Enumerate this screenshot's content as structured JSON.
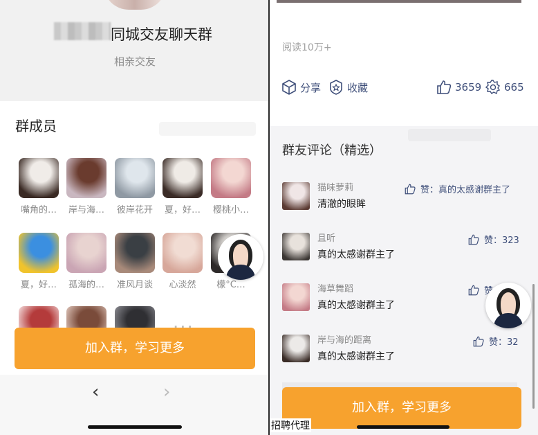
{
  "left": {
    "group_name": "同城交友聊天群",
    "group_subtitle": "相亲交友",
    "members_title": "群成员",
    "members": [
      {
        "name": "嘴角的…",
        "color1": "#f0ece8",
        "color2": "#3a2a24"
      },
      {
        "name": "岸与海…",
        "color1": "#6a3b2e",
        "color2": "#c9b7c0"
      },
      {
        "name": "彼岸花开",
        "color1": "#dfe6ec",
        "color2": "#8f99a3"
      },
      {
        "name": "夏，好…",
        "color1": "#efebe6",
        "color2": "#3b2c27"
      },
      {
        "name": "樱桃小…",
        "color1": "#f3d7d2",
        "color2": "#c47b86"
      },
      {
        "name": "夏，好…",
        "color1": "#3b8fe0",
        "color2": "#f0c32c"
      },
      {
        "name": "孤海的…",
        "color1": "#e8d3d0",
        "color2": "#caa5b4"
      },
      {
        "name": "准风月谈",
        "color1": "#3a3f44",
        "color2": "#a88a7a"
      },
      {
        "name": "心淡然",
        "color1": "#f1dcd3",
        "color2": "#d7a79a"
      },
      {
        "name": "檬°C…",
        "color1": "#e4e1dd",
        "color2": "#2e2a2a"
      },
      {
        "name": "",
        "color1": "#b43b3b",
        "color2": "#f4dcdc"
      },
      {
        "name": "",
        "color1": "#7a4b3a",
        "color2": "#ddc3b8"
      },
      {
        "name": "",
        "color1": "#2f2f33",
        "color2": "#8a8a90"
      }
    ],
    "cta_label": "加入群，学习更多",
    "nav_prev": "‹",
    "nav_next": "›"
  },
  "right": {
    "read_count": "阅读10万+",
    "share_label": "分享",
    "collect_label": "收藏",
    "like_count": "3659",
    "love_count": "665",
    "comments_title": "群友评论（精选）",
    "comments": [
      {
        "user": "猫味萝莉",
        "text": "清澈的眼眸",
        "like": "赞：真的太感谢群主了",
        "c1": "#f0e6e6",
        "c2": "#5b3b33"
      },
      {
        "user": "且听",
        "text": "真的太感谢群主了",
        "like": "赞：323",
        "c1": "#e8e2dc",
        "c2": "#3b3633"
      },
      {
        "user": "海草舞蹈",
        "text": "真的太感谢群主了",
        "like": "赞",
        "c1": "#f3d7d2",
        "c2": "#c47b86"
      },
      {
        "user": "岸与海的距离",
        "text": "真的太感谢群主了",
        "like": "赞：32",
        "c1": "#eceae8",
        "c2": "#3a2c27"
      }
    ],
    "cta_label": "加入群，学习更多",
    "footer_text": "招聘代理"
  },
  "colors": {
    "accent": "#f7a22e",
    "link": "#3f4f7a"
  }
}
